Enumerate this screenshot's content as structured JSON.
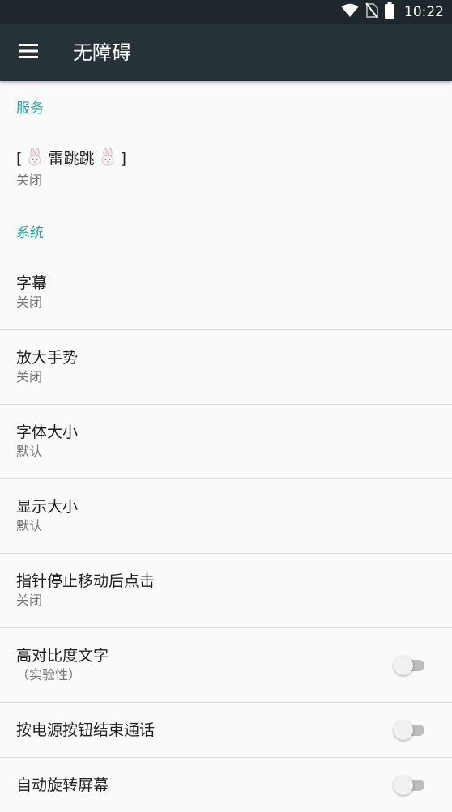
{
  "status_bar": {
    "time": "10:22",
    "icons": [
      "wifi-icon",
      "no-sim-icon",
      "battery-icon"
    ]
  },
  "app_bar": {
    "title": "无障碍",
    "menu_icon": "hamburger-menu-icon"
  },
  "sections": {
    "services": {
      "header": "服务",
      "items": [
        {
          "title_prefix": "[ ",
          "title_main": " 雷跳跳 ",
          "title_suffix": " ]",
          "summary": "关闭"
        }
      ]
    },
    "system": {
      "header": "系统",
      "items": [
        {
          "title": "字幕",
          "summary": "关闭"
        },
        {
          "title": "放大手势",
          "summary": "关闭"
        },
        {
          "title": "字体大小",
          "summary": "默认"
        },
        {
          "title": "显示大小",
          "summary": "默认"
        },
        {
          "title": "指针停止移动后点击",
          "summary": "关闭"
        },
        {
          "title": "高对比度文字",
          "summary": "（实验性）",
          "toggle": false
        },
        {
          "title": "按电源按钮结束通话",
          "toggle": false
        },
        {
          "title": "自动旋转屏幕",
          "toggle": false
        }
      ]
    }
  },
  "colors": {
    "status_bar": "#1e272c",
    "app_bar": "#263238",
    "accent": "#26a69a",
    "background": "#fafafa"
  }
}
